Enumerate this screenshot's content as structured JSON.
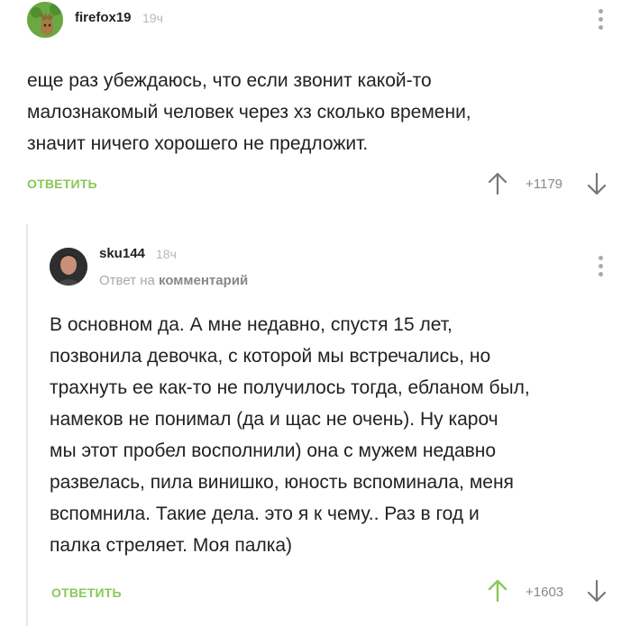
{
  "comments": [
    {
      "username": "firefox19",
      "time": "19ч",
      "text_lines": [
        "еще раз убеждаюсь, что если звонит какой-то",
        "малознакомый человек через хз сколько времени,",
        "значит ничего хорошего не предложит."
      ],
      "reply_label": "ОТВЕТИТЬ",
      "score": "+1179",
      "upvoted": false
    },
    {
      "username": "sku144",
      "time": "18ч",
      "reply_prefix": "Ответ на",
      "reply_target": "комментарий",
      "text_lines": [
        "В основном да. А мне недавно, спустя 15 лет,",
        "позвонила девочка, с которой мы встречались, но",
        "трахнуть ее как-то не получилось тогда, ебланом был,",
        "намеков не понимал (да и щас не очень). Ну кароч",
        "мы этот пробел восполнили) она с мужем недавно",
        "развелась, пила винишко, юность вспоминала, меня",
        "вспомнила. Такие дела. это я к чему.. Раз в год и",
        "палка стреляет. Моя палка)"
      ],
      "reply_label": "ОТВЕТИТЬ",
      "score": "+1603",
      "upvoted": true
    }
  ],
  "colors": {
    "accent_green": "#8ac858",
    "muted_gray": "#888888",
    "thread_line": "#e6e6e6"
  }
}
